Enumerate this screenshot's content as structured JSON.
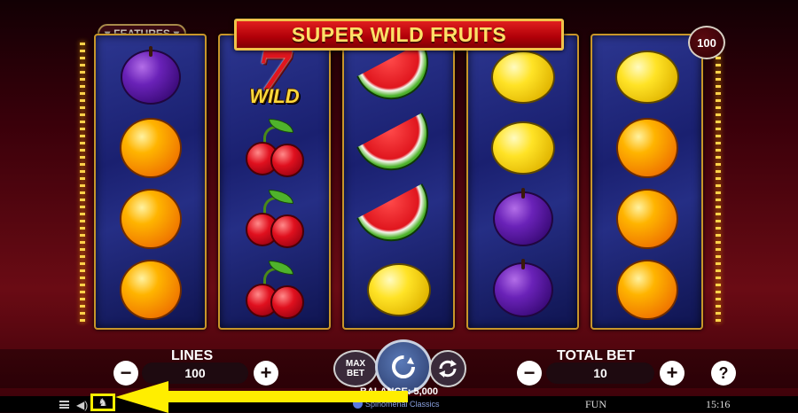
{
  "game": {
    "title": "SUPER WILD FRUITS",
    "features_label": "FEATURES",
    "lines_badge": "100"
  },
  "reels": [
    [
      "plum",
      "orange",
      "orange",
      "orange"
    ],
    [
      "wild-seven",
      "cherry",
      "cherry",
      "cherry"
    ],
    [
      "watermelon",
      "watermelon",
      "watermelon",
      "lemon"
    ],
    [
      "lemon",
      "lemon",
      "plum",
      "plum"
    ],
    [
      "lemon",
      "orange",
      "orange",
      "orange"
    ]
  ],
  "wild_symbol": {
    "digit": "7",
    "text": "WILD"
  },
  "controls": {
    "lines_label": "LINES",
    "lines_value": "100",
    "total_bet_label": "TOTAL BET",
    "total_bet_value": "10",
    "minus": "−",
    "plus": "+",
    "max_bet_line1": "MAX",
    "max_bet_line2": "BET",
    "help": "?"
  },
  "status": {
    "balance": "BALANCE: 5,000",
    "provider": "Spinomenal Classics",
    "mode": "FUN",
    "time": "15:16"
  },
  "colors": {
    "accent_gold": "#f0c24a",
    "title_red": "#b00008",
    "highlight_yellow": "#ffee00"
  }
}
